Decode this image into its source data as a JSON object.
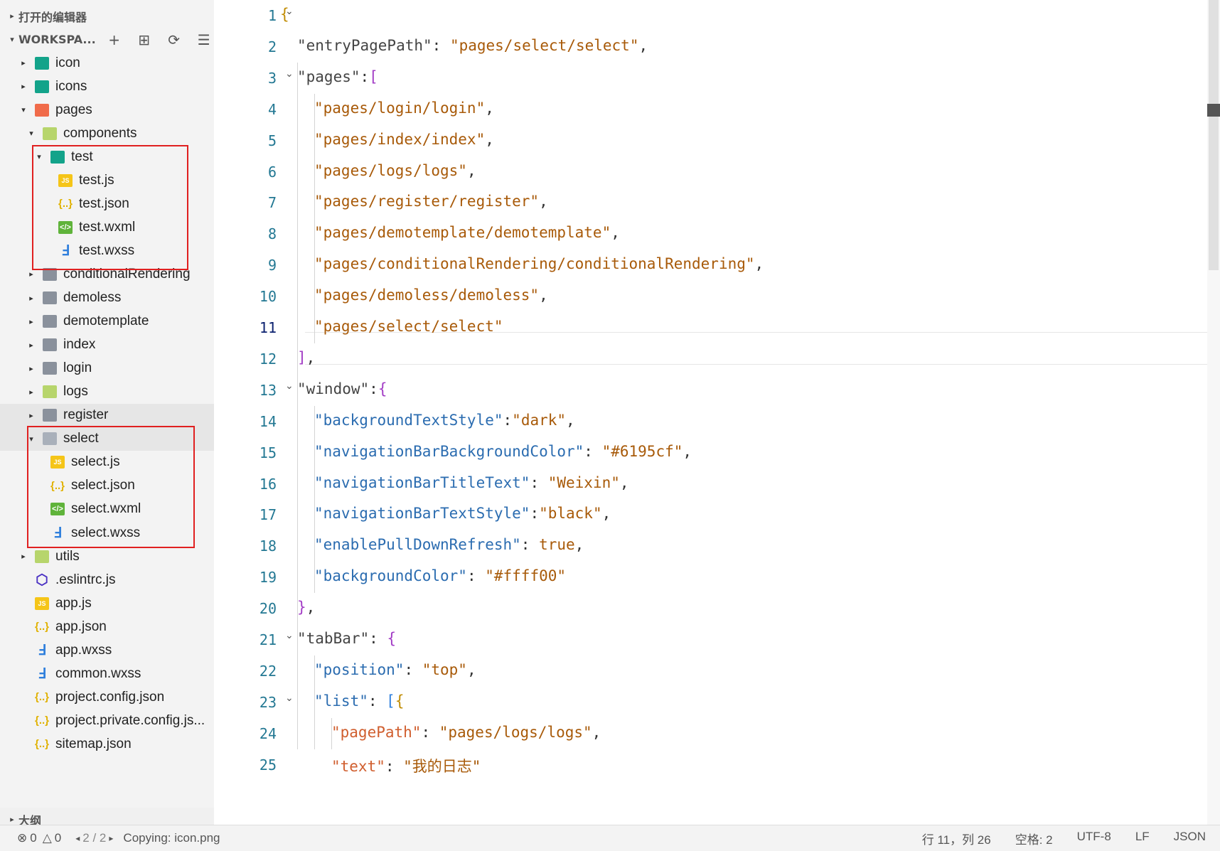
{
  "sidebar": {
    "open_editors_label": "打开的编辑器",
    "workspace_label": "WORKSPA...",
    "outline_label": "大纲",
    "tree": [
      {
        "label": "icon",
        "icon": "folder-teal-icon",
        "depth": 0,
        "twisty": "▸"
      },
      {
        "label": "icons",
        "icon": "folder-teal-icon",
        "depth": 0,
        "twisty": "▸"
      },
      {
        "label": "pages",
        "icon": "folder-red-icon",
        "depth": 0,
        "twisty": "▾"
      },
      {
        "label": "components",
        "icon": "folder-lime-icon",
        "depth": 1,
        "twisty": "▾"
      },
      {
        "label": "test",
        "icon": "folder-teal-icon",
        "depth": 2,
        "twisty": "▾"
      },
      {
        "label": "test.js",
        "icon": "js-file-icon",
        "depth": 3,
        "twisty": ""
      },
      {
        "label": "test.json",
        "icon": "json-file-icon",
        "depth": 3,
        "twisty": ""
      },
      {
        "label": "test.wxml",
        "icon": "wxml-file-icon",
        "depth": 3,
        "twisty": ""
      },
      {
        "label": "test.wxss",
        "icon": "wxss-file-icon",
        "depth": 3,
        "twisty": ""
      },
      {
        "label": "conditionalRendering",
        "icon": "folder-icon",
        "depth": 1,
        "twisty": "▸"
      },
      {
        "label": "demoless",
        "icon": "folder-icon",
        "depth": 1,
        "twisty": "▸"
      },
      {
        "label": "demotemplate",
        "icon": "folder-icon",
        "depth": 1,
        "twisty": "▸"
      },
      {
        "label": "index",
        "icon": "folder-icon",
        "depth": 1,
        "twisty": "▸"
      },
      {
        "label": "login",
        "icon": "folder-icon",
        "depth": 1,
        "twisty": "▸"
      },
      {
        "label": "logs",
        "icon": "folder-lime-icon",
        "depth": 1,
        "twisty": "▸"
      },
      {
        "label": "register",
        "icon": "folder-icon",
        "depth": 1,
        "twisty": "▸"
      },
      {
        "label": "select",
        "icon": "folder-open-icon",
        "depth": 1,
        "twisty": "▾"
      },
      {
        "label": "select.js",
        "icon": "js-file-icon",
        "depth": 2,
        "twisty": ""
      },
      {
        "label": "select.json",
        "icon": "json-file-icon",
        "depth": 2,
        "twisty": ""
      },
      {
        "label": "select.wxml",
        "icon": "wxml-file-icon",
        "depth": 2,
        "twisty": ""
      },
      {
        "label": "select.wxss",
        "icon": "wxss-file-icon",
        "depth": 2,
        "twisty": ""
      },
      {
        "label": "utils",
        "icon": "folder-lime-icon",
        "depth": 0,
        "twisty": "▸"
      },
      {
        "label": ".eslintrc.js",
        "icon": "eslint-file-icon",
        "depth": 0,
        "twisty": ""
      },
      {
        "label": "app.js",
        "icon": "js-file-icon",
        "depth": 0,
        "twisty": ""
      },
      {
        "label": "app.json",
        "icon": "json-file-icon",
        "depth": 0,
        "twisty": ""
      },
      {
        "label": "app.wxss",
        "icon": "wxss-file-icon",
        "depth": 0,
        "twisty": ""
      },
      {
        "label": "common.wxss",
        "icon": "wxss-file-icon",
        "depth": 0,
        "twisty": ""
      },
      {
        "label": "project.config.json",
        "icon": "json-file-icon",
        "depth": 0,
        "twisty": ""
      },
      {
        "label": "project.private.config.js...",
        "icon": "json-file-icon",
        "depth": 0,
        "twisty": ""
      },
      {
        "label": "sitemap.json",
        "icon": "json-file-icon",
        "depth": 0,
        "twisty": ""
      }
    ],
    "highlight_colors": {
      "annotation_box": "#e02020"
    }
  },
  "editor": {
    "current_line": "11",
    "lines": [
      {
        "n": "1",
        "indent": 0,
        "fold": true,
        "tokens": [
          {
            "t": "{",
            "c": "b1"
          }
        ]
      },
      {
        "n": "2",
        "indent": 1,
        "fold": false,
        "tokens": [
          {
            "t": "\"entryPagePath\"",
            "c": "kk"
          },
          {
            "t": ": ",
            "c": "p"
          },
          {
            "t": "\"pages/select/select\"",
            "c": "s"
          },
          {
            "t": ",",
            "c": "p"
          }
        ]
      },
      {
        "n": "3",
        "indent": 1,
        "fold": true,
        "tokens": [
          {
            "t": "\"pages\"",
            "c": "kk"
          },
          {
            "t": ":",
            "c": "p"
          },
          {
            "t": "[",
            "c": "b2"
          }
        ]
      },
      {
        "n": "4",
        "indent": 2,
        "fold": false,
        "tokens": [
          {
            "t": "\"pages/login/login\"",
            "c": "s"
          },
          {
            "t": ",",
            "c": "p"
          }
        ]
      },
      {
        "n": "5",
        "indent": 2,
        "fold": false,
        "tokens": [
          {
            "t": "\"pages/index/index\"",
            "c": "s"
          },
          {
            "t": ",",
            "c": "p"
          }
        ]
      },
      {
        "n": "6",
        "indent": 2,
        "fold": false,
        "tokens": [
          {
            "t": "\"pages/logs/logs\"",
            "c": "s"
          },
          {
            "t": ",",
            "c": "p"
          }
        ]
      },
      {
        "n": "7",
        "indent": 2,
        "fold": false,
        "tokens": [
          {
            "t": "\"pages/register/register\"",
            "c": "s"
          },
          {
            "t": ",",
            "c": "p"
          }
        ]
      },
      {
        "n": "8",
        "indent": 2,
        "fold": false,
        "tokens": [
          {
            "t": "\"pages/demotemplate/demotemplate\"",
            "c": "s"
          },
          {
            "t": ",",
            "c": "p"
          }
        ]
      },
      {
        "n": "9",
        "indent": 2,
        "fold": false,
        "tokens": [
          {
            "t": "\"pages/conditionalRendering/conditionalRendering\"",
            "c": "s"
          },
          {
            "t": ",",
            "c": "p"
          }
        ]
      },
      {
        "n": "10",
        "indent": 2,
        "fold": false,
        "tokens": [
          {
            "t": "\"pages/demoless/demoless\"",
            "c": "s"
          },
          {
            "t": ",",
            "c": "p"
          }
        ]
      },
      {
        "n": "11",
        "indent": 2,
        "fold": false,
        "tokens": [
          {
            "t": "\"pages/select/select\"",
            "c": "s"
          }
        ]
      },
      {
        "n": "12",
        "indent": 1,
        "fold": false,
        "tokens": [
          {
            "t": "]",
            "c": "b2"
          },
          {
            "t": ",",
            "c": "p"
          }
        ]
      },
      {
        "n": "13",
        "indent": 1,
        "fold": true,
        "tokens": [
          {
            "t": "\"window\"",
            "c": "kk"
          },
          {
            "t": ":",
            "c": "p"
          },
          {
            "t": "{",
            "c": "b2"
          }
        ]
      },
      {
        "n": "14",
        "indent": 2,
        "fold": false,
        "tokens": [
          {
            "t": "\"backgroundTextStyle\"",
            "c": "k"
          },
          {
            "t": ":",
            "c": "p"
          },
          {
            "t": "\"dark\"",
            "c": "s"
          },
          {
            "t": ",",
            "c": "p"
          }
        ]
      },
      {
        "n": "15",
        "indent": 2,
        "fold": false,
        "tokens": [
          {
            "t": "\"navigationBarBackgroundColor\"",
            "c": "k"
          },
          {
            "t": ": ",
            "c": "p"
          },
          {
            "t": "\"#6195cf\"",
            "c": "s"
          },
          {
            "t": ",",
            "c": "p"
          }
        ]
      },
      {
        "n": "16",
        "indent": 2,
        "fold": false,
        "tokens": [
          {
            "t": "\"navigationBarTitleText\"",
            "c": "k"
          },
          {
            "t": ": ",
            "c": "p"
          },
          {
            "t": "\"Weixin\"",
            "c": "s"
          },
          {
            "t": ",",
            "c": "p"
          }
        ]
      },
      {
        "n": "17",
        "indent": 2,
        "fold": false,
        "tokens": [
          {
            "t": "\"navigationBarTextStyle\"",
            "c": "k"
          },
          {
            "t": ":",
            "c": "p"
          },
          {
            "t": "\"black\"",
            "c": "s"
          },
          {
            "t": ",",
            "c": "p"
          }
        ]
      },
      {
        "n": "18",
        "indent": 2,
        "fold": false,
        "tokens": [
          {
            "t": "\"enablePullDownRefresh\"",
            "c": "k"
          },
          {
            "t": ": ",
            "c": "p"
          },
          {
            "t": "true",
            "c": "s"
          },
          {
            "t": ",",
            "c": "p"
          }
        ]
      },
      {
        "n": "19",
        "indent": 2,
        "fold": false,
        "tokens": [
          {
            "t": "\"backgroundColor\"",
            "c": "k"
          },
          {
            "t": ": ",
            "c": "p"
          },
          {
            "t": "\"#ffff00\"",
            "c": "s"
          }
        ]
      },
      {
        "n": "20",
        "indent": 1,
        "fold": false,
        "tokens": [
          {
            "t": "}",
            "c": "b2"
          },
          {
            "t": ",",
            "c": "p"
          }
        ]
      },
      {
        "n": "21",
        "indent": 1,
        "fold": true,
        "tokens": [
          {
            "t": "\"tabBar\"",
            "c": "kk"
          },
          {
            "t": ": ",
            "c": "p"
          },
          {
            "t": "{",
            "c": "b2"
          }
        ]
      },
      {
        "n": "22",
        "indent": 2,
        "fold": false,
        "tokens": [
          {
            "t": "\"position\"",
            "c": "k"
          },
          {
            "t": ": ",
            "c": "p"
          },
          {
            "t": "\"top\"",
            "c": "s"
          },
          {
            "t": ",",
            "c": "p"
          }
        ]
      },
      {
        "n": "23",
        "indent": 2,
        "fold": true,
        "tokens": [
          {
            "t": "\"list\"",
            "c": "k"
          },
          {
            "t": ": ",
            "c": "p"
          },
          {
            "t": "[",
            "c": "b3"
          },
          {
            "t": "{",
            "c": "b1"
          }
        ]
      },
      {
        "n": "24",
        "indent": 3,
        "fold": false,
        "tokens": [
          {
            "t": "\"pagePath\"",
            "c": "ko"
          },
          {
            "t": ": ",
            "c": "p"
          },
          {
            "t": "\"pages/logs/logs\"",
            "c": "s"
          },
          {
            "t": ",",
            "c": "p"
          }
        ]
      },
      {
        "n": "25",
        "indent": 3,
        "fold": false,
        "tokens": [
          {
            "t": "\"text\"",
            "c": "ko"
          },
          {
            "t": ": ",
            "c": "p"
          },
          {
            "t": "\"我的日志\"",
            "c": "s"
          }
        ]
      }
    ]
  },
  "status": {
    "errors": "0",
    "warnings": "0",
    "page": "2 / 2",
    "message": "Copying: icon.png",
    "cursor": "行 11，列 26",
    "spaces": "空格: 2",
    "encoding": "UTF-8",
    "eol": "LF",
    "language": "JSON"
  }
}
